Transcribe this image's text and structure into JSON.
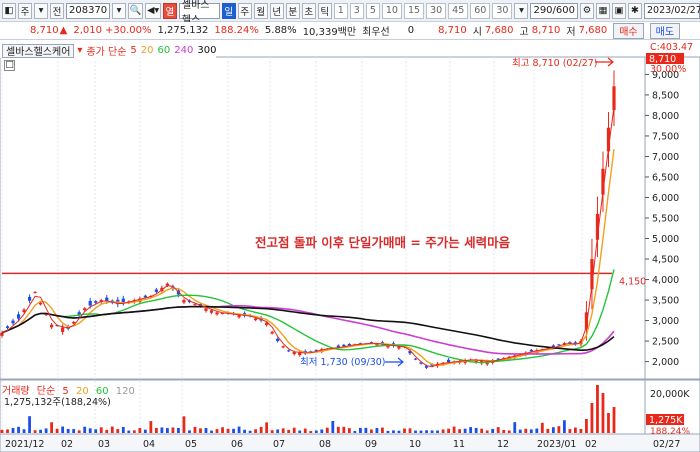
{
  "toolbar": {
    "tab_main": "주",
    "tab_all": "전",
    "code": "208370",
    "stock_name": "셀바스헬스",
    "period_day": "일",
    "period_week": "주",
    "period_month": "월",
    "period_year": "년",
    "period_min": "분",
    "period_sec": "초",
    "period_tick": "틱",
    "intervals": [
      "1",
      "3",
      "5",
      "10",
      "15",
      "30",
      "45",
      "60",
      "30"
    ],
    "count": "290/600",
    "date": "2023/02/27"
  },
  "quote": {
    "price": "8,710",
    "change": "2,010",
    "change_pct": "+30.00%",
    "volume": "1,275,132",
    "vol_ratio": "188.24%",
    "turnover": "5.88%",
    "amount": "10,339백만",
    "best_bid_label": "최우선",
    "best_bid": "0",
    "price2": "8,710",
    "open_label": "시",
    "open": "7,680",
    "high_label": "고",
    "high": "8,710",
    "low_label": "저",
    "low": "7,680",
    "buy": "매수",
    "sell": "매도"
  },
  "legend": {
    "name": "셀바스헬스케어",
    "ma_label": "종가 단순",
    "ma_periods": [
      "5",
      "20",
      "60",
      "240",
      "300"
    ],
    "ma_colors": [
      "#e8281b",
      "#f0a01e",
      "#22c43a",
      "#c93fd1",
      "#111111"
    ],
    "collapse": "□"
  },
  "volume_legend": {
    "label": "거래량",
    "ma_label": "단순",
    "ma_periods": [
      "5",
      "20",
      "60",
      "120"
    ],
    "value": "1,275,132주(188,24%)"
  },
  "chart_data": {
    "type": "candlestick",
    "y_ticks": [
      "9,000",
      "8,500",
      "8,000",
      "7,500",
      "7,000",
      "6,500",
      "6,000",
      "5,500",
      "5,000",
      "4,500",
      "4,000",
      "3,500",
      "3,000",
      "2,500",
      "2,000"
    ],
    "ylim": [
      1600,
      9400
    ],
    "top_labels": [
      "C:403.47",
      "8,710",
      "30.00%"
    ],
    "x_ticks": [
      "2021/12",
      "02",
      "03",
      "04",
      "05",
      "06",
      "07",
      "08",
      "09",
      "10",
      "11",
      "12",
      "2023/01",
      "02",
      "02/27"
    ],
    "high_annotation": "최고 8,710 (02/27)",
    "low_annotation": "최저 1,730 (09/30)",
    "headline": "전고점 돌파 이후 단일가매매 = 주가는 세력마음",
    "resistance_value": "4,150",
    "resistance": 4150,
    "volume_ticks": [
      "20,000K",
      "1,275K",
      "188.24%"
    ],
    "price_path": [
      [
        0,
        2700
      ],
      [
        3,
        3050
      ],
      [
        6,
        3700
      ],
      [
        9,
        2900
      ],
      [
        12,
        2800
      ],
      [
        15,
        3300
      ],
      [
        18,
        3500
      ],
      [
        21,
        3400
      ],
      [
        24,
        3500
      ],
      [
        27,
        3600
      ],
      [
        30,
        3900
      ],
      [
        33,
        3500
      ],
      [
        36,
        3350
      ],
      [
        39,
        3200
      ],
      [
        42,
        3150
      ],
      [
        45,
        3100
      ],
      [
        48,
        2950
      ],
      [
        50,
        2500
      ],
      [
        52,
        2250
      ],
      [
        55,
        2200
      ],
      [
        58,
        2300
      ],
      [
        61,
        2350
      ],
      [
        64,
        2420
      ],
      [
        67,
        2450
      ],
      [
        70,
        2400
      ],
      [
        73,
        2350
      ],
      [
        75,
        2050
      ],
      [
        77,
        1850
      ],
      [
        79,
        1950
      ],
      [
        82,
        2000
      ],
      [
        85,
        2050
      ],
      [
        88,
        2000
      ],
      [
        90,
        2050
      ],
      [
        93,
        2150
      ],
      [
        96,
        2250
      ],
      [
        98,
        2300
      ],
      [
        100,
        2350
      ],
      [
        102,
        2450
      ],
      [
        104,
        2420
      ],
      [
        105,
        2500
      ],
      [
        106,
        3200
      ],
      [
        107,
        4500
      ],
      [
        108,
        5600
      ],
      [
        109,
        6700
      ],
      [
        110,
        7700
      ],
      [
        111,
        8710
      ]
    ]
  }
}
